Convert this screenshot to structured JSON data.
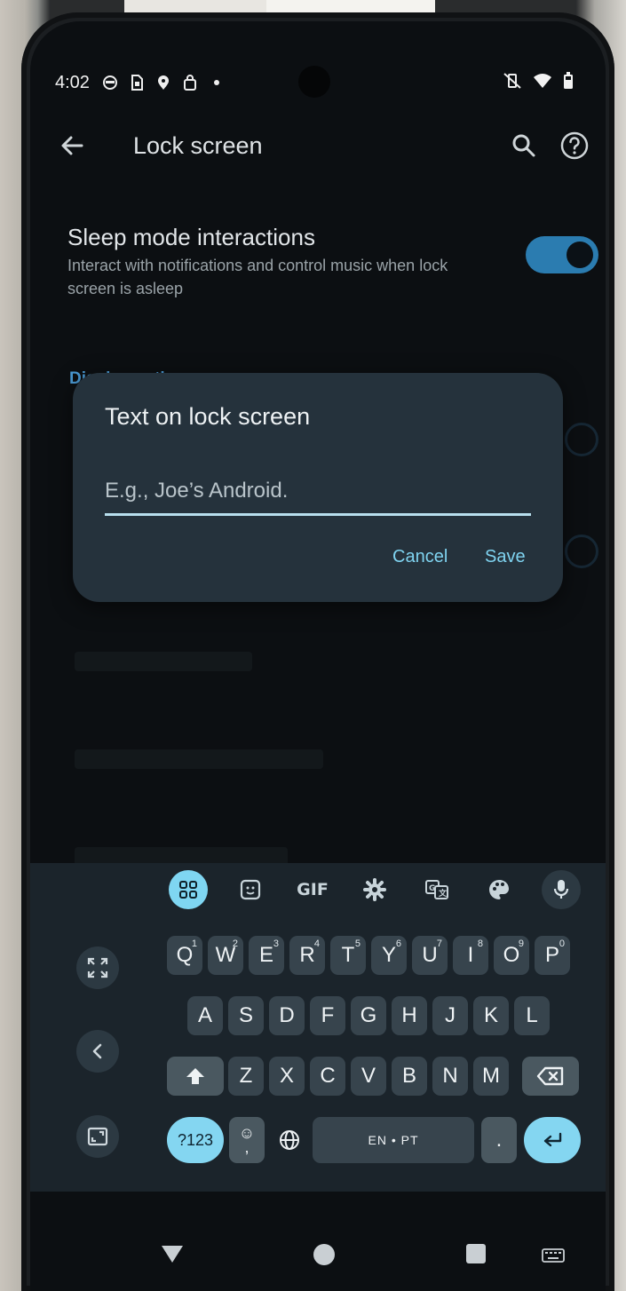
{
  "status_bar": {
    "time": "4:02"
  },
  "app_bar": {
    "title": "Lock screen"
  },
  "settings": {
    "sleep_mode": {
      "title": "Sleep mode interactions",
      "subtitle": "Interact with notifications and control music when lock screen is asleep",
      "enabled": true
    },
    "section_display_options": "Display options"
  },
  "dialog": {
    "title": "Text on lock screen",
    "input_value": "",
    "input_placeholder": "E.g., Joe’s Android.",
    "cancel_label": "Cancel",
    "save_label": "Save"
  },
  "keyboard": {
    "toolbar": {
      "gif_label": "GIF"
    },
    "row1": [
      {
        "key": "Q",
        "hint": "1"
      },
      {
        "key": "W",
        "hint": "2"
      },
      {
        "key": "E",
        "hint": "3"
      },
      {
        "key": "R",
        "hint": "4"
      },
      {
        "key": "T",
        "hint": "5"
      },
      {
        "key": "Y",
        "hint": "6"
      },
      {
        "key": "U",
        "hint": "7"
      },
      {
        "key": "I",
        "hint": "8"
      },
      {
        "key": "O",
        "hint": "9"
      },
      {
        "key": "P",
        "hint": "0"
      }
    ],
    "row2": [
      "A",
      "S",
      "D",
      "F",
      "G",
      "H",
      "J",
      "K",
      "L"
    ],
    "row3": [
      "Z",
      "X",
      "C",
      "V",
      "B",
      "N",
      "M"
    ],
    "symbols_label": "?123",
    "space_label": "EN • PT",
    "period_label": ".",
    "comma_label": ","
  },
  "colors": {
    "accent": "#7fd6f2",
    "toggle_on": "#2b7cb0",
    "section_header": "#4a9ad4",
    "dialog_bg": "#25323c"
  }
}
